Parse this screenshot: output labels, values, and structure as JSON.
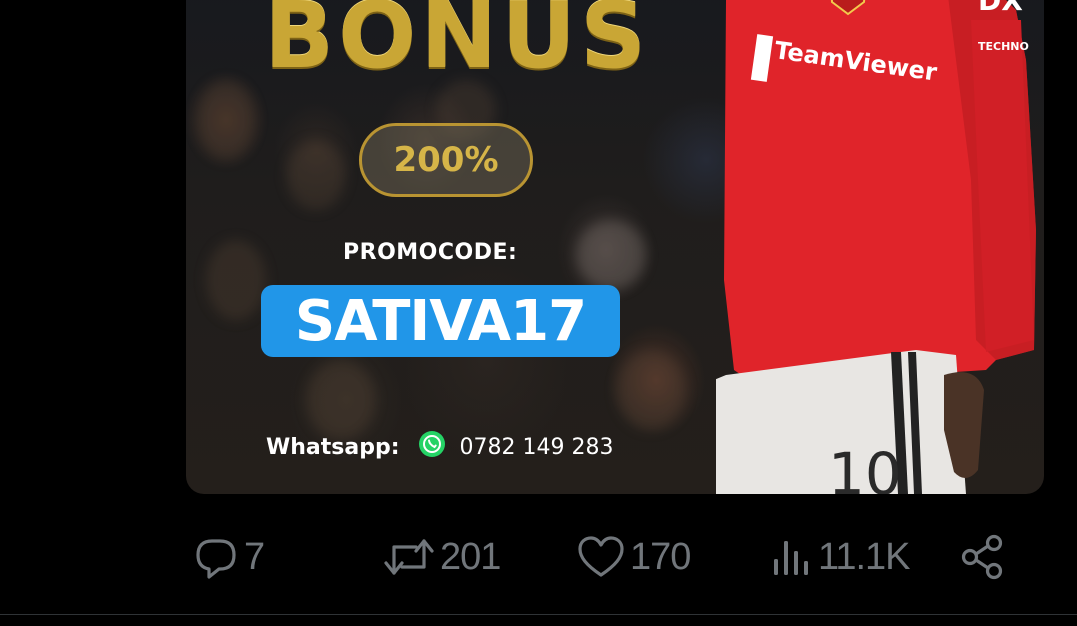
{
  "post_media": {
    "headline": "BONUS",
    "bonus_percent": "200%",
    "promocode_label": "PROMOCODE:",
    "promocode": "SATIVA17",
    "contact_label": "Whatsapp:",
    "contact_phone": "0782 149 283",
    "sponsor_text": "TeamViewer",
    "sponsor_secondary": "TECHNO",
    "jersey_number": "10"
  },
  "actions": {
    "replies": "7",
    "reposts": "201",
    "likes": "170",
    "views": "11.1K"
  },
  "colors": {
    "background": "#000000",
    "action_gray": "#71767b",
    "gold": "#c9a635",
    "promo_blue": "#2196e8",
    "jersey_red": "#e0242a",
    "whatsapp_green": "#25d366"
  }
}
